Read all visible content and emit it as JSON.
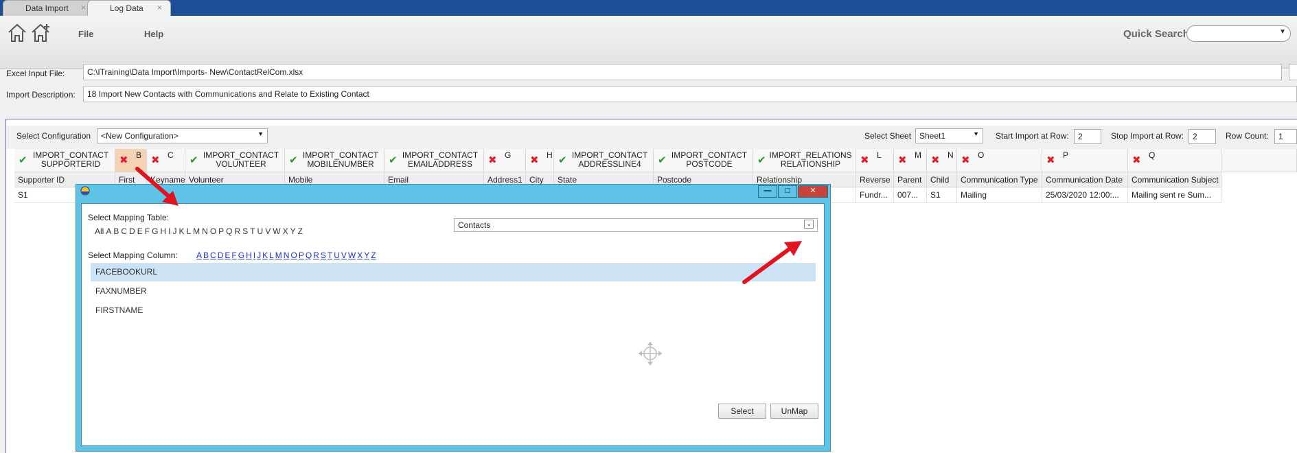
{
  "tabs": [
    {
      "label": "Data Import",
      "close": "×"
    },
    {
      "label": "Log Data",
      "close": "×"
    }
  ],
  "ribbon": {
    "menu": [
      "File",
      "Help"
    ],
    "quick_search_label": "Quick Search",
    "quick_search_value": ""
  },
  "file_fields": {
    "excel_label": "Excel Input File:",
    "excel_value": "C:\\ITraining\\Data Import\\Imports- New\\ContactRelCom.xlsx",
    "desc_label": "Import Description:",
    "desc_value": "18 Import New Contacts with Communications and Relate to Existing Contact"
  },
  "config": {
    "select_config_label": "Select Configuration",
    "select_config_value": "<New Configuration>",
    "select_sheet_label": "Select Sheet",
    "select_sheet_value": "Sheet1",
    "start_row_label": "Start Import at Row:",
    "start_row_value": "2",
    "stop_row_label": "Stop Import at Row:",
    "stop_row_value": "2",
    "row_count_label": "Row Count:",
    "row_count_value": "1"
  },
  "grid": {
    "columns": [
      {
        "mapped": true,
        "l1": "IMPORT_CONTACT",
        "l2": "SUPPORTERID",
        "sub": "Supporter ID",
        "cell": "S1"
      },
      {
        "mapped": false,
        "l1": "B",
        "l2": "",
        "sub": "First",
        "cell": ""
      },
      {
        "mapped": false,
        "l1": "C",
        "l2": "",
        "sub": "Keyname",
        "cell": ""
      },
      {
        "mapped": true,
        "l1": "IMPORT_CONTACT",
        "l2": "VOLUNTEER",
        "sub": "Volunteer",
        "cell": ""
      },
      {
        "mapped": true,
        "l1": "IMPORT_CONTACT",
        "l2": "MOBILENUMBER",
        "sub": "Mobile",
        "cell": ""
      },
      {
        "mapped": true,
        "l1": "IMPORT_CONTACT",
        "l2": "EMAILADDRESS",
        "sub": "Email",
        "cell": ""
      },
      {
        "mapped": false,
        "l1": "G",
        "l2": "",
        "sub": "Address1",
        "cell": ""
      },
      {
        "mapped": false,
        "l1": "H",
        "l2": "",
        "sub": "City",
        "cell": ""
      },
      {
        "mapped": true,
        "l1": "IMPORT_CONTACT",
        "l2": "ADDRESSLINE4",
        "sub": "State",
        "cell": ""
      },
      {
        "mapped": true,
        "l1": "IMPORT_CONTACT",
        "l2": "POSTCODE",
        "sub": "Postcode",
        "cell": ""
      },
      {
        "mapped": true,
        "l1": "IMPORT_RELATIONS",
        "l2": "RELATIONSHIP",
        "sub": "Relationship",
        "cell": ""
      },
      {
        "mapped": false,
        "l1": "L",
        "l2": "",
        "sub": "Reverse",
        "cell": "Fundr..."
      },
      {
        "mapped": false,
        "l1": "M",
        "l2": "",
        "sub": "Parent",
        "cell": "007..."
      },
      {
        "mapped": false,
        "l1": "N",
        "l2": "",
        "sub": "Child",
        "cell": "S1"
      },
      {
        "mapped": false,
        "l1": "O",
        "l2": "",
        "sub": "Communication Type",
        "cell": "Mailing"
      },
      {
        "mapped": false,
        "l1": "P",
        "l2": "",
        "sub": "Communication Date",
        "cell": "25/03/2020 12:00:..."
      },
      {
        "mapped": false,
        "l1": "Q",
        "l2": "",
        "sub": "Communication Subject",
        "cell": "Mailing sent re Sum..."
      }
    ],
    "check_icon": "✔",
    "cross_icon": "✖"
  },
  "dialog": {
    "table_label": "Select Mapping Table:",
    "table_letters": [
      "All",
      "A",
      "B",
      "C",
      "D",
      "E",
      "F",
      "G",
      "H",
      "I",
      "J",
      "K",
      "L",
      "M",
      "N",
      "O",
      "P",
      "Q",
      "R",
      "S",
      "T",
      "U",
      "V",
      "W",
      "X",
      "Y",
      "Z"
    ],
    "table_value": "Contacts",
    "column_label": "Select Mapping Column:",
    "column_letters": [
      "A",
      "B",
      "C",
      "D",
      "E",
      "F",
      "G",
      "H",
      "I",
      "J",
      "K",
      "L",
      "M",
      "N",
      "O",
      "P",
      "Q",
      "R",
      "S",
      "T",
      "U",
      "V",
      "W",
      "X",
      "Y",
      "Z"
    ],
    "rows": [
      "FACEBOOKURL",
      "FAXNUMBER",
      "FIRSTNAME"
    ],
    "selected_row": 0,
    "select_button": "Select",
    "unmap_button": "UnMap",
    "minimize": "—",
    "maximize": "□",
    "close": "✕"
  },
  "colors": {
    "tabstrip": "#1c4f96",
    "dialog_frame": "#5ec3e6",
    "selected_row": "#cce3f5",
    "arrow": "#e0141e"
  }
}
